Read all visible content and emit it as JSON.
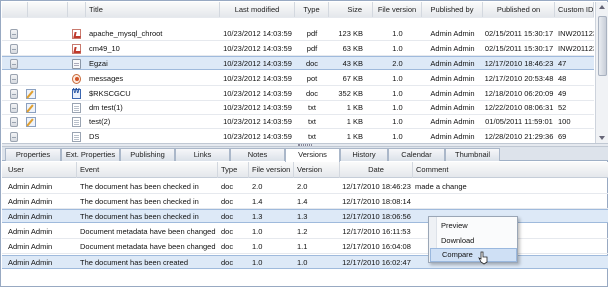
{
  "top_grid": {
    "columns": [
      "Title",
      "Last modified",
      "Type",
      "Size",
      "File version",
      "Published by",
      "Published on",
      "Custom ID"
    ],
    "rows": [
      {
        "icon": "pdf-icon",
        "title": "apache_mysql_chroot",
        "modified": "10/23/2012 14:03:59",
        "type": "pdf",
        "size": "123 KB",
        "version": "1.0",
        "published_by": "Admin Admin",
        "published_on": "02/15/2011 15:30:17",
        "custom_id": "INW2011236"
      },
      {
        "icon": "pdf-icon",
        "title": "cm49_10",
        "modified": "10/23/2012 14:03:59",
        "type": "pdf",
        "size": "63 KB",
        "version": "1.0",
        "published_by": "Admin Admin",
        "published_on": "02/15/2011 15:30:17",
        "custom_id": "INW2011236"
      },
      {
        "icon": "doc-icon",
        "title": "Egzai",
        "modified": "10/23/2012 14:03:59",
        "type": "doc",
        "size": "43 KB",
        "version": "2.0",
        "published_by": "Admin Admin",
        "published_on": "12/17/2010 18:46:23",
        "custom_id": "47",
        "selected": true
      },
      {
        "icon": "ppt-icon",
        "title": "messages",
        "modified": "10/23/2012 14:03:59",
        "type": "pot",
        "size": "67 KB",
        "version": "1.0",
        "published_by": "Admin Admin",
        "published_on": "12/17/2010 20:53:48",
        "custom_id": "48"
      },
      {
        "icon": "word-icon",
        "title": "$RKSCGCU",
        "modified": "10/23/2012 14:03:59",
        "type": "doc",
        "size": "352 KB",
        "version": "1.0",
        "published_by": "Admin Admin",
        "published_on": "12/18/2010 06:20:09",
        "custom_id": "49"
      },
      {
        "icon": "txt-icon",
        "title": "dm test(1)",
        "modified": "10/23/2012 14:03:59",
        "type": "txt",
        "size": "1 KB",
        "version": "1.0",
        "published_by": "Admin Admin",
        "published_on": "12/22/2010 08:06:31",
        "custom_id": "52",
        "edit": true
      },
      {
        "icon": "txt-icon",
        "title": "test(2)",
        "modified": "10/23/2012 14:03:59",
        "type": "txt",
        "size": "1 KB",
        "version": "1.0",
        "published_by": "Admin Admin",
        "published_on": "01/05/2011 11:59:01",
        "custom_id": "100",
        "edit": true
      },
      {
        "icon": "txt-icon",
        "title": "DS",
        "modified": "10/23/2012 14:03:59",
        "type": "txt",
        "size": "1 KB",
        "version": "1.0",
        "published_by": "Admin Admin",
        "published_on": "12/28/2010 21:29:36",
        "custom_id": "69"
      }
    ]
  },
  "tabs": [
    "Properties",
    "Ext. Properties",
    "Publishing",
    "Links",
    "Notes",
    "Versions",
    "History",
    "Calendar",
    "Thumbnail"
  ],
  "active_tab": "Versions",
  "versions_grid": {
    "columns": [
      "User",
      "Event",
      "Type",
      "File version",
      "Version",
      "Date",
      "Comment"
    ],
    "rows": [
      {
        "user": "Admin Admin",
        "event": "The document has been checked in",
        "type": "doc",
        "file_version": "2.0",
        "version": "2.0",
        "date": "12/17/2010 18:46:23",
        "comment": "made a change"
      },
      {
        "user": "Admin Admin",
        "event": "The document has been checked in",
        "type": "doc",
        "file_version": "1.4",
        "version": "1.4",
        "date": "12/17/2010 18:08:14",
        "comment": ""
      },
      {
        "user": "Admin Admin",
        "event": "The document has been checked in",
        "type": "doc",
        "file_version": "1.3",
        "version": "1.3",
        "date": "12/17/2010 18:06:56",
        "comment": "",
        "selected": true
      },
      {
        "user": "Admin Admin",
        "event": "Document metadata have been changed",
        "type": "doc",
        "file_version": "1.0",
        "version": "1.2",
        "date": "12/17/2010 16:11:53",
        "comment": ""
      },
      {
        "user": "Admin Admin",
        "event": "Document metadata have been changed",
        "type": "doc",
        "file_version": "1.0",
        "version": "1.1",
        "date": "12/17/2010 16:04:08",
        "comment": ""
      },
      {
        "user": "Admin Admin",
        "event": "The document has been created",
        "type": "doc",
        "file_version": "1.0",
        "version": "1.0",
        "date": "12/17/2010 16:02:47",
        "comment": "",
        "selected": true
      }
    ]
  },
  "context_menu": {
    "items": [
      "Preview",
      "Download",
      "Compare"
    ],
    "hovered": "Compare"
  }
}
